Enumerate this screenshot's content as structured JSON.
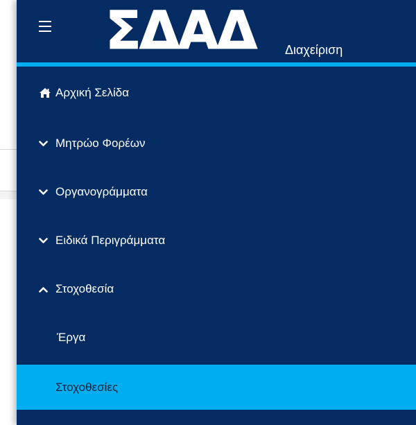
{
  "header": {
    "logo_text": "ΣΔΑΔ",
    "subtitle": "Διαχείριση"
  },
  "nav": {
    "items": [
      {
        "label": "Αρχική Σελίδα",
        "icon": "home-icon"
      },
      {
        "label": "Μητρώο Φορέων",
        "icon": "chevron-down-icon"
      },
      {
        "label": "Οργανογράμματα",
        "icon": "chevron-down-icon"
      },
      {
        "label": "Ειδικά Περιγράμματα",
        "icon": "chevron-down-icon"
      },
      {
        "label": "Στοχοθεσία",
        "icon": "chevron-up-icon"
      },
      {
        "label": "Έργα"
      },
      {
        "label": "Στοχοθεσίες",
        "active": true
      }
    ]
  },
  "colors": {
    "sidebar_bg": "#042b62",
    "accent": "#00aeef",
    "active_text": "#0d2340"
  }
}
